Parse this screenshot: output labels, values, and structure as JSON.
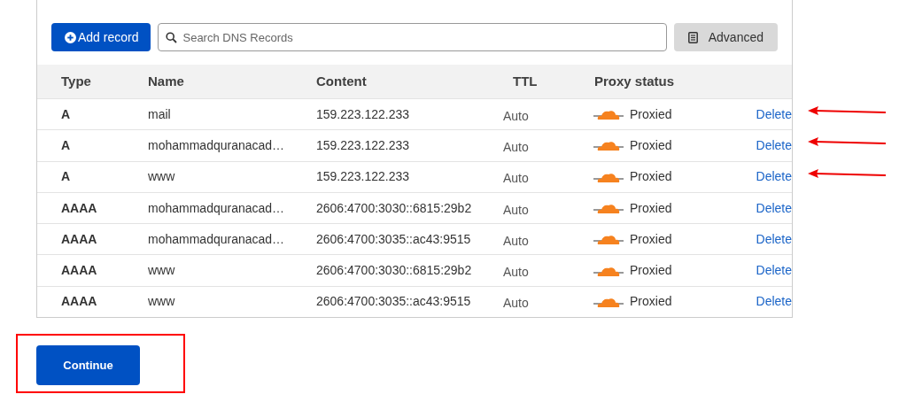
{
  "toolbar": {
    "add_button": "Add record",
    "search": {
      "placeholder": "Search DNS Records"
    },
    "advanced_button": "Advanced"
  },
  "table": {
    "columns": [
      "Type",
      "Name",
      "Content",
      "TTL",
      "Proxy status"
    ],
    "rows": [
      {
        "type": "A",
        "name": "mail",
        "content": "159.223.122.233",
        "ttl": "Auto",
        "proxy": "Proxied",
        "action": "Delete",
        "arrow": true
      },
      {
        "type": "A",
        "name": "mohammadquranacad…",
        "content": "159.223.122.233",
        "ttl": "Auto",
        "proxy": "Proxied",
        "action": "Delete",
        "arrow": true
      },
      {
        "type": "A",
        "name": "www",
        "content": "159.223.122.233",
        "ttl": "Auto",
        "proxy": "Proxied",
        "action": "Delete",
        "arrow": true
      },
      {
        "type": "AAAA",
        "name": "mohammadquranacad…",
        "content": "2606:4700:3030::6815:29b2",
        "ttl": "Auto",
        "proxy": "Proxied",
        "action": "Delete",
        "arrow": false
      },
      {
        "type": "AAAA",
        "name": "mohammadquranacad…",
        "content": "2606:4700:3035::ac43:9515",
        "ttl": "Auto",
        "proxy": "Proxied",
        "action": "Delete",
        "arrow": false
      },
      {
        "type": "AAAA",
        "name": "www",
        "content": "2606:4700:3030::6815:29b2",
        "ttl": "Auto",
        "proxy": "Proxied",
        "action": "Delete",
        "arrow": false
      },
      {
        "type": "AAAA",
        "name": "www",
        "content": "2606:4700:3035::ac43:9515",
        "ttl": "Auto",
        "proxy": "Proxied",
        "action": "Delete",
        "arrow": false
      }
    ]
  },
  "continue_button": {
    "label": "Continue",
    "highlighted": true
  }
}
